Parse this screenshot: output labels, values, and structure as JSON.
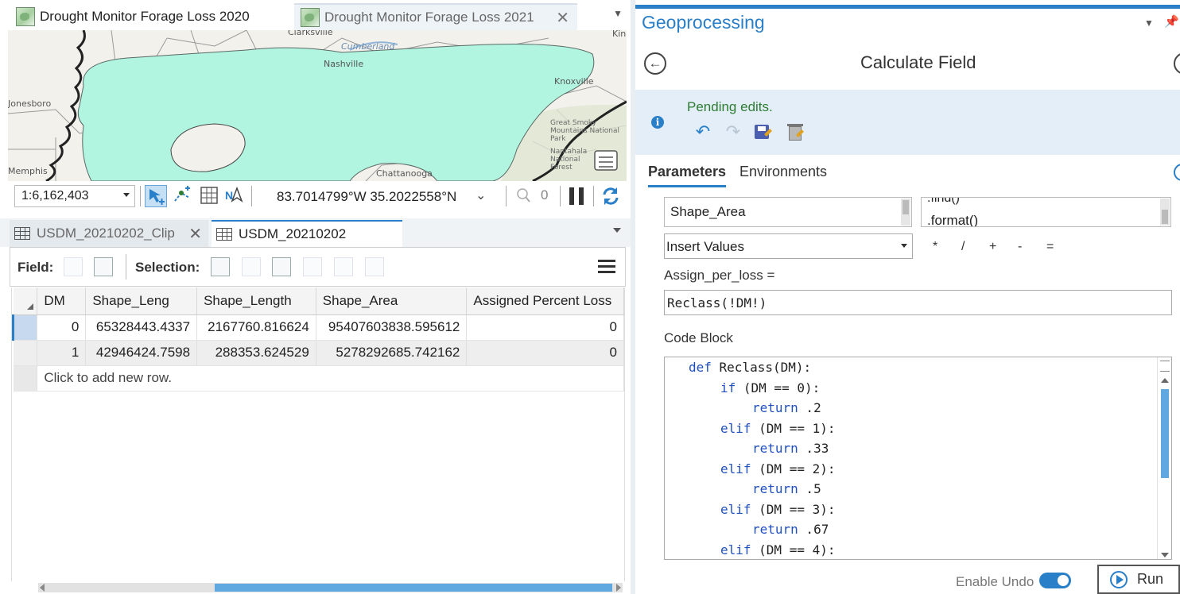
{
  "map_view": {
    "tabs": [
      {
        "label": "Drought Monitor Forage Loss 2020",
        "active": true
      },
      {
        "label": "Drought Monitor Forage Loss 2021",
        "active": false
      }
    ],
    "close_glyph": "✕",
    "dropdown_glyph": "▼",
    "place_labels": {
      "clarksville": "Clarksville",
      "nashville": "Nashville",
      "cumberland": "Cumberland",
      "knoxville": "Knoxville",
      "jonesboro": "Jonesboro",
      "memphis": "Memphis",
      "chattanooga": "Chattanooga",
      "great_smoky": "Great Smoky Mountains National Park",
      "nantahala": "Nantahala National Forest",
      "kingsport": "Kin"
    },
    "colors": {
      "drought_polygon": "#b1f4df",
      "basemap": "#f3f1ec",
      "boundary": "#222222"
    }
  },
  "status_bar": {
    "scale": "1:6,162,403",
    "coordinates": "83.7014799°W 35.2022558°N",
    "coords_dropdown": "⌄",
    "selected_count": "0",
    "icons": [
      "navigate-icon",
      "snapping-icon",
      "grid-icon",
      "north-arrow-icon",
      "zoom-selected-icon",
      "pause-icon",
      "refresh-icon"
    ]
  },
  "table_view": {
    "tabs": [
      {
        "label": "USDM_20210202_Clip",
        "active": false
      },
      {
        "label": "USDM_20210202",
        "active": true
      }
    ],
    "close_glyph": "✕",
    "toolbar": {
      "field_label": "Field:",
      "selection_label": "Selection:"
    },
    "columns": [
      "DM",
      "Shape_Leng",
      "Shape_Length",
      "Shape_Area",
      "Assigned Percent Loss"
    ],
    "rows": [
      [
        "0",
        "65328443.4337",
        "2167760.816624",
        "95407603838.595612",
        "0"
      ],
      [
        "1",
        "42946424.7598",
        "288353.624529",
        "5278292685.742162",
        "0"
      ]
    ],
    "add_row_text": "Click to add new row."
  },
  "geoprocessing": {
    "pane_title": "Geoprocessing",
    "pin_glyph": "ꟷ",
    "tool_title": "Calculate Field",
    "back_glyph": "←",
    "message": "Pending edits.",
    "info_glyph": "i",
    "undo_glyph": "↶",
    "redo_glyph": "↷",
    "tabs": {
      "parameters": "Parameters",
      "environments": "Environments"
    },
    "fields_list_selected": "Shape_Area",
    "helpers_list_prev": ".find()",
    "helpers_list_selected": ".format()",
    "insert_values": "Insert Values",
    "operators": [
      "*",
      "/",
      "+",
      "-",
      "="
    ],
    "expression_label": "Assign_per_loss =",
    "expression": "Reclass(!DM!)",
    "code_block_label": "Code Block",
    "code_lines": [
      {
        "kw": "def",
        "rest": " Reclass(DM):",
        "indent": 0
      },
      {
        "kw": "if",
        "rest": " (DM == 0):",
        "indent": 1
      },
      {
        "kw": "return",
        "rest": " .2",
        "indent": 2
      },
      {
        "kw": "elif",
        "rest": " (DM == 1):",
        "indent": 1
      },
      {
        "kw": "return",
        "rest": " .33",
        "indent": 2
      },
      {
        "kw": "elif",
        "rest": " (DM == 2):",
        "indent": 1
      },
      {
        "kw": "return",
        "rest": " .5",
        "indent": 2
      },
      {
        "kw": "elif",
        "rest": " (DM == 3):",
        "indent": 1
      },
      {
        "kw": "return",
        "rest": " .67",
        "indent": 2
      },
      {
        "kw": "elif",
        "rest": " (DM == 4):",
        "indent": 1
      }
    ],
    "enable_undo_label": "Enable Undo",
    "enable_undo_on": true,
    "run_label": "Run",
    "accent_color": "#2a7fc9",
    "success_color": "#2e7d32"
  }
}
